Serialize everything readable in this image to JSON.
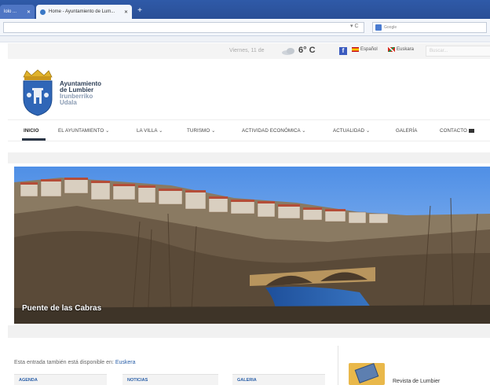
{
  "browser": {
    "tabs": [
      {
        "title": "lolo ...",
        "active": false
      },
      {
        "title": "Home - Ayuntamiento de Lum...",
        "active": true
      }
    ],
    "new_tab_label": "+",
    "url_tools": "▾ C",
    "search_engine_placeholder": "Google"
  },
  "utility": {
    "date": "Viernes, 11 de",
    "temperature": "6° C",
    "facebook_label": "f",
    "languages": [
      {
        "label": "Español",
        "flag": "es"
      },
      {
        "label": "Euskara",
        "flag": "eu"
      }
    ],
    "search_placeholder": "Buscar..."
  },
  "header": {
    "logo_line1": "Ayuntamiento",
    "logo_line2": "de Lumbier",
    "logo_line3": "Irunberriko",
    "logo_line4": "Udala"
  },
  "nav": {
    "items": [
      {
        "label": "INICIO",
        "has_dropdown": false,
        "active": true
      },
      {
        "label": "EL AYUNTAMIENTO",
        "has_dropdown": true,
        "active": false
      },
      {
        "label": "LA VILLA",
        "has_dropdown": true,
        "active": false
      },
      {
        "label": "TURISMO",
        "has_dropdown": true,
        "active": false
      },
      {
        "label": "ACTIVIDAD ECONÓMICA",
        "has_dropdown": true,
        "active": false
      },
      {
        "label": "ACTUALIDAD",
        "has_dropdown": true,
        "active": false
      },
      {
        "label": "GALERÍA",
        "has_dropdown": false,
        "active": false
      },
      {
        "label": "CONTACTO",
        "has_dropdown": false,
        "active": false
      }
    ]
  },
  "hero": {
    "caption": "Puente de las Cabras"
  },
  "content": {
    "notice_text": "Esta entrada también está disponible en:",
    "notice_link": "Euskera",
    "boxes": [
      {
        "label": "AGENDA"
      },
      {
        "label": "NOTICIAS"
      },
      {
        "label": "GALERIA"
      }
    ],
    "magazine_label": "Revista de Lumbier"
  },
  "colors": {
    "tabbar": "#2f5aa8",
    "nav_underline": "#2b3646",
    "link": "#2a5fa8",
    "facebook": "#3b5bbf"
  }
}
